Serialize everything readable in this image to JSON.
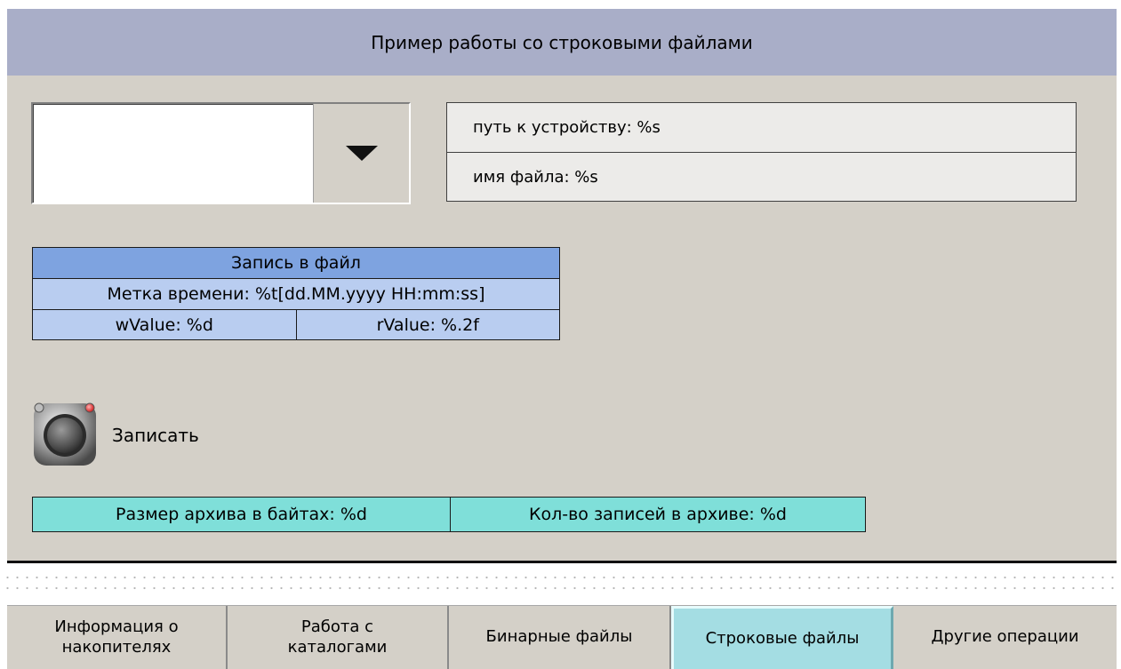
{
  "header": {
    "title": "Пример работы со строковыми файлами"
  },
  "device_path": {
    "path_label": "путь к устройству: %s",
    "file_label": "имя файла: %s"
  },
  "write_table": {
    "title": "Запись в файл",
    "timestamp": "Метка времени: %t[dd.MM.yyyy  HH:mm:ss]",
    "wvalue": "wValue: %d",
    "rvalue": "rValue: %.2f"
  },
  "write_button": {
    "label": "Записать"
  },
  "archive": {
    "size_label": "Размер архива в байтах: %d",
    "count_label": "Кол-во записей в архиве: %d"
  },
  "nav": {
    "tabs": [
      {
        "line1": "Информация о",
        "line2": "накопителях",
        "active": false
      },
      {
        "line1": "Работа с",
        "line2": "каталогами",
        "active": false
      },
      {
        "line1": "Бинарные файлы",
        "line2": "",
        "active": false
      },
      {
        "line1": "Строковые файлы",
        "line2": "",
        "active": true
      },
      {
        "line1": "Другие операции",
        "line2": "",
        "active": false
      }
    ]
  },
  "colors": {
    "header_bg": "#a9aec8",
    "panel_bg": "#d4d0c8",
    "table_header": "#7ea3e0",
    "table_row": "#b9cdf0",
    "archive_bg": "#7fdfd9",
    "active_tab": "#a4dde3"
  },
  "icons": {
    "combo_arrow": "triangle-down-icon",
    "write_button": "round-push-button-icon"
  }
}
